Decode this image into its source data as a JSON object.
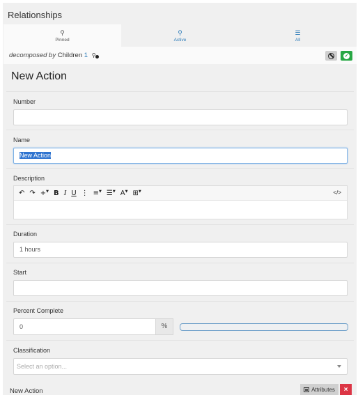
{
  "panel": {
    "title": "Relationships",
    "tabs": [
      {
        "label": "Pinned",
        "icon": "pin-icon",
        "glyph": "⚲",
        "active": true
      },
      {
        "label": "Active",
        "icon": "map-marker-icon",
        "glyph": "♁",
        "active": false
      },
      {
        "label": "All",
        "icon": "list-icon",
        "glyph": "☰",
        "active": false
      }
    ],
    "relation": {
      "type_label": "decomposed by",
      "target": "Children",
      "count": "1"
    }
  },
  "form": {
    "title": "New Action",
    "fields": {
      "number": {
        "label": "Number",
        "value": ""
      },
      "name": {
        "label": "Name",
        "value": "New Action"
      },
      "description": {
        "label": "Description",
        "value": ""
      },
      "duration": {
        "label": "Duration",
        "value": "1 hours"
      },
      "start": {
        "label": "Start",
        "value": ""
      },
      "percent_complete": {
        "label": "Percent Complete",
        "value": "0",
        "unit": "%",
        "progress_fraction": 0
      },
      "classification": {
        "label": "Classification",
        "placeholder": "Select an option..."
      }
    },
    "toolbar": {
      "undo": "↶",
      "redo": "↷",
      "insert": "+",
      "bold": "B",
      "italic": "I",
      "underline": "U",
      "more": "⋮",
      "align": "≡",
      "list": "☰",
      "font": "A",
      "table": "⊞",
      "code": "</>"
    }
  },
  "footer": {
    "title": "New Action",
    "attributes_label": "Attributes",
    "delete_label": "×"
  },
  "colors": {
    "accent": "#2a7ab8",
    "success": "#28a745",
    "danger": "#dc3545"
  }
}
